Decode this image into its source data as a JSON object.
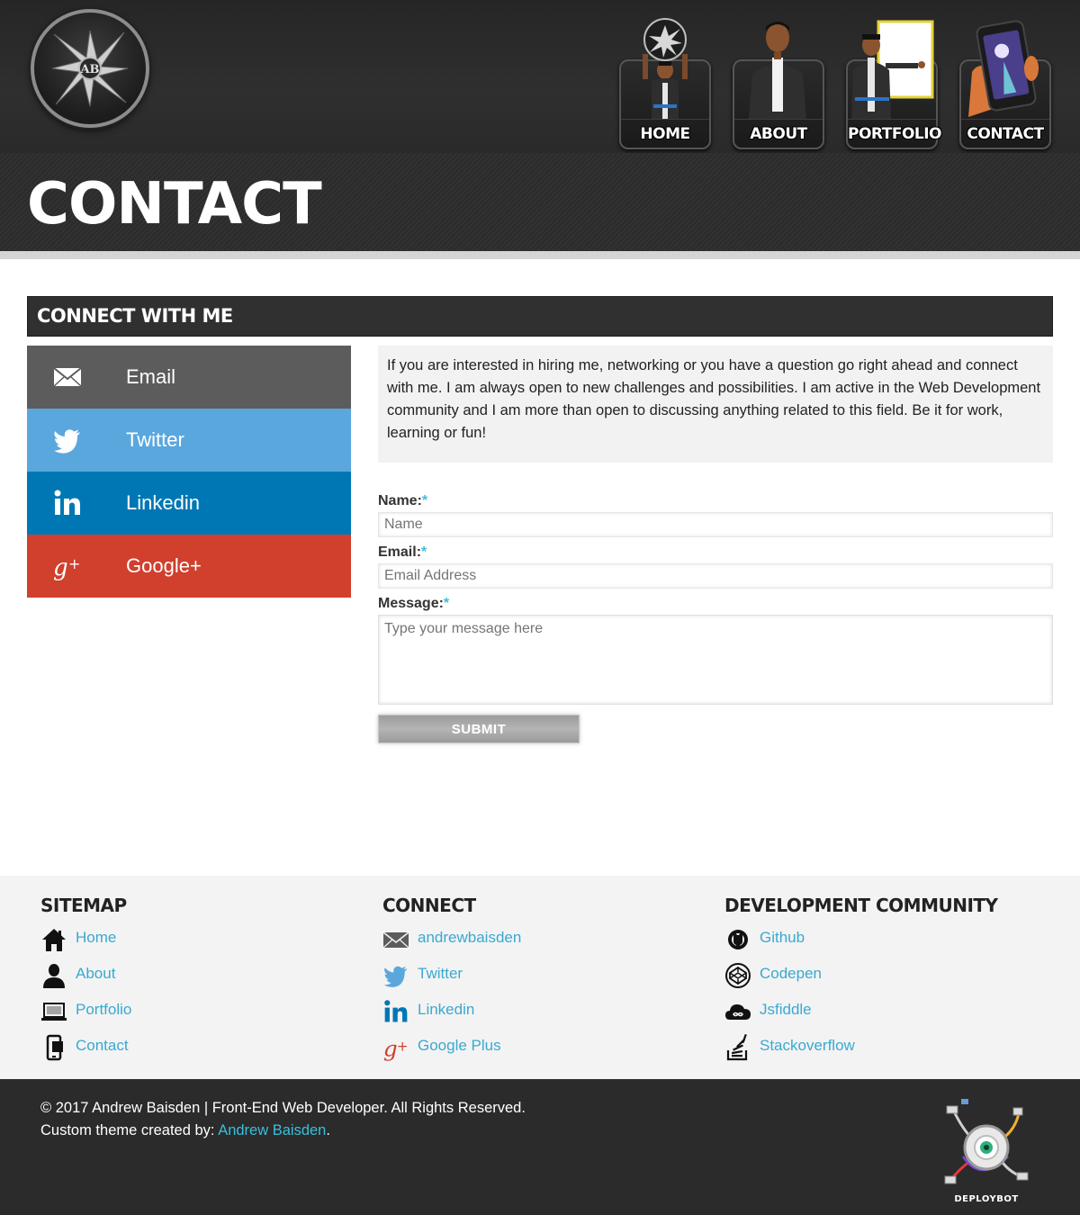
{
  "header": {
    "logo_alt": "AB",
    "nav": [
      {
        "label": "HOME"
      },
      {
        "label": "ABOUT"
      },
      {
        "label": "PORTFOLIO"
      },
      {
        "label": "CONTACT"
      }
    ]
  },
  "page": {
    "title": "CONTACT"
  },
  "connect": {
    "heading": "CONNECT WITH ME",
    "buttons": [
      {
        "label": "Email",
        "icon": "envelope-icon",
        "color": "#5c5c5c"
      },
      {
        "label": "Twitter",
        "icon": "twitter-bird-icon",
        "color": "#5aa7de"
      },
      {
        "label": "Linkedin",
        "icon": "linkedin-icon",
        "color": "#0077b5"
      },
      {
        "label": "Google+",
        "icon": "google-plus-icon",
        "color": "#d13f2d"
      }
    ],
    "intro": "If you are interested in hiring me, networking or you have a question go right ahead and connect with me. I am always open to new challenges and possibilities. I am active in the Web Development community and I am more than open to discussing anything related to this field. Be it for work, learning or fun!"
  },
  "form": {
    "name_label": "Name:",
    "name_placeholder": "Name",
    "email_label": "Email:",
    "email_placeholder": "Email Address",
    "message_label": "Message:",
    "message_placeholder": "Type your message here",
    "required_mark": "*",
    "submit_label": "SUBMIT"
  },
  "footer": {
    "sitemap": {
      "heading": "SITEMAP",
      "links": [
        {
          "label": "Home",
          "icon": "house-icon"
        },
        {
          "label": "About",
          "icon": "person-icon"
        },
        {
          "label": "Portfolio",
          "icon": "laptop-icon"
        },
        {
          "label": "Contact",
          "icon": "phone-icon"
        }
      ]
    },
    "connect": {
      "heading": "CONNECT",
      "links": [
        {
          "label": "andrewbaisden",
          "icon": "envelope-icon"
        },
        {
          "label": "Twitter",
          "icon": "twitter-bird-icon"
        },
        {
          "label": "Linkedin",
          "icon": "linkedin-icon"
        },
        {
          "label": "Google Plus",
          "icon": "google-plus-icon"
        }
      ]
    },
    "community": {
      "heading": "DEVELOPMENT COMMUNITY",
      "links": [
        {
          "label": "Github",
          "icon": "github-icon"
        },
        {
          "label": "Codepen",
          "icon": "codepen-icon"
        },
        {
          "label": "Jsfiddle",
          "icon": "jsfiddle-icon"
        },
        {
          "label": "Stackoverflow",
          "icon": "stackoverflow-icon"
        }
      ]
    },
    "copyright": "© 2017 Andrew Baisden | Front-End Web Developer. All Rights Reserved.",
    "credit_prefix": "Custom theme created by: ",
    "credit_name": "Andrew Baisden",
    "credit_suffix": ".",
    "badge_label": "DEPLOYBOT"
  },
  "colors": {
    "accent": "#3bbfdc",
    "link": "#3aa9cf",
    "header_bg": "#2b2b2b"
  }
}
